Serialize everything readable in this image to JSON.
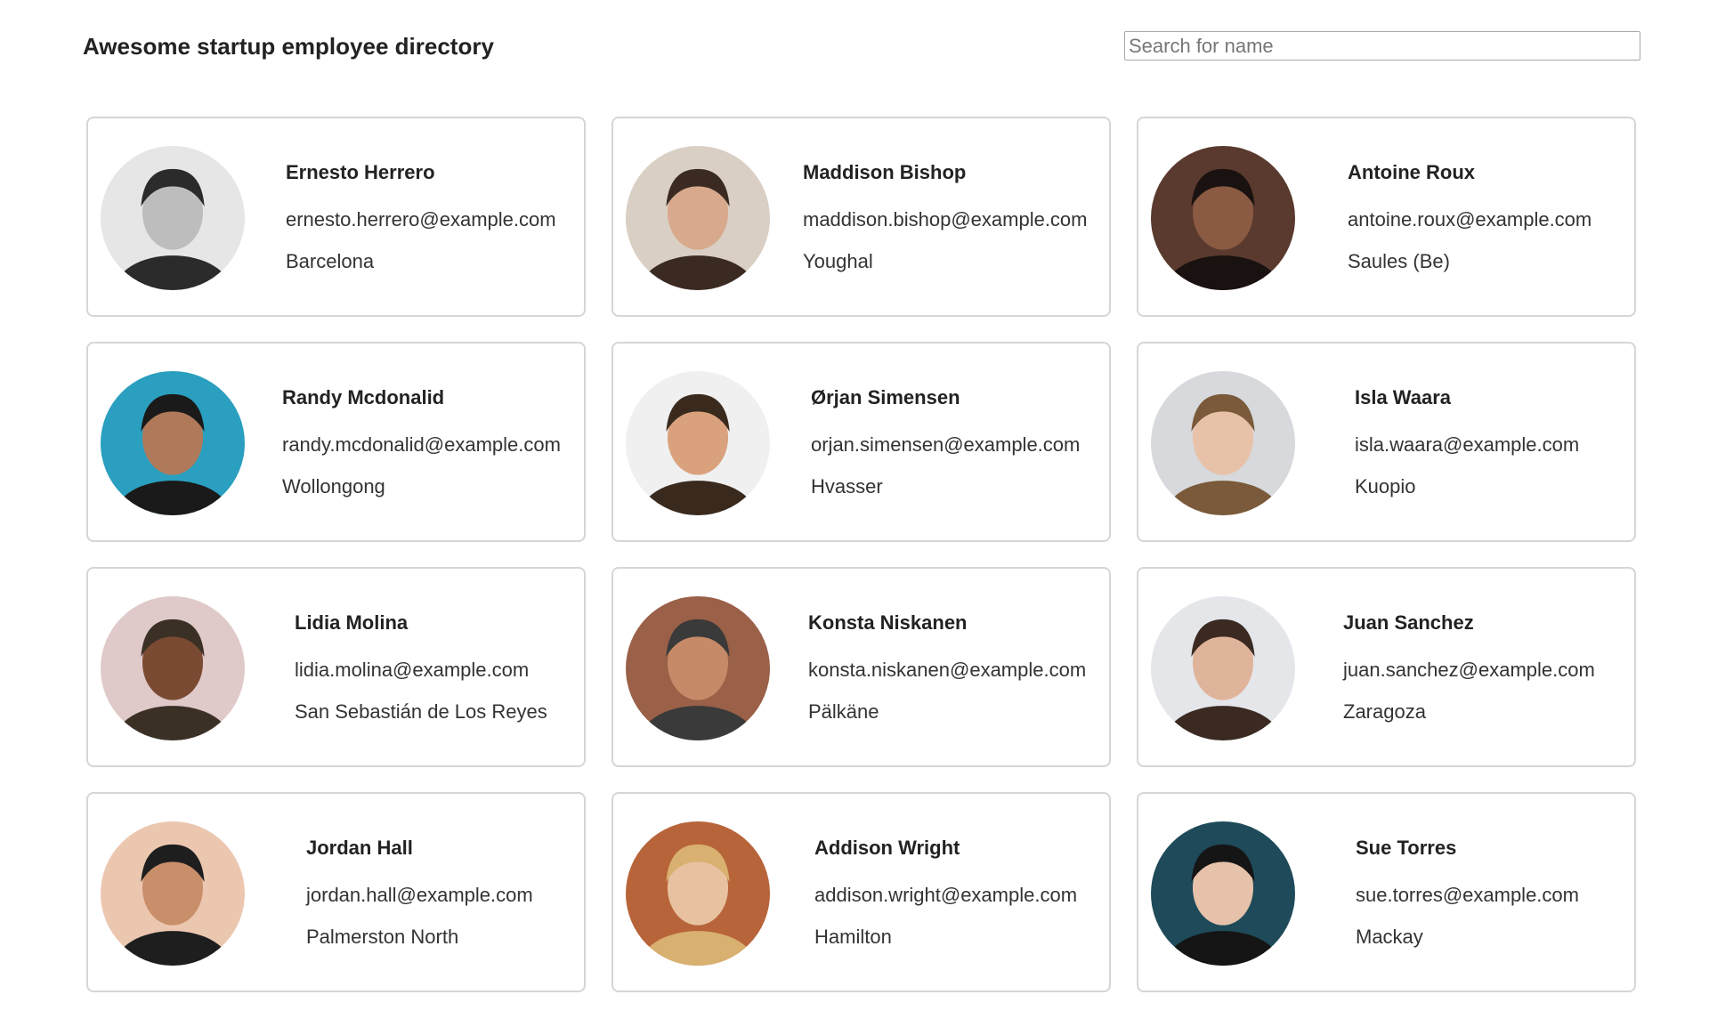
{
  "header": {
    "title": "Awesome startup employee directory",
    "search_placeholder": "Search for name",
    "search_value": ""
  },
  "colors": {
    "card_border": "#d6d6d6",
    "text": "#222222",
    "search_border": "#a8a8a8"
  },
  "employees": [
    {
      "name": "Ernesto Herrero",
      "email": "ernesto.herrero@example.com",
      "city": "Barcelona",
      "photo": "avatar-photo",
      "palette": [
        "#e6e6e6",
        "#2b2b2b",
        "#bdbdbd"
      ]
    },
    {
      "name": "Maddison Bishop",
      "email": "maddison.bishop@example.com",
      "city": "Youghal",
      "photo": "avatar-photo",
      "palette": [
        "#d9cfc4",
        "#3a2a22",
        "#d8a98c"
      ]
    },
    {
      "name": "Antoine Roux",
      "email": "antoine.roux@example.com",
      "city": "Saules (Be)",
      "photo": "avatar-photo",
      "palette": [
        "#5a3a2e",
        "#1a1210",
        "#8a5a42"
      ]
    },
    {
      "name": "Randy Mcdonalid",
      "email": "randy.mcdonalid@example.com",
      "city": "Wollongong",
      "photo": "avatar-photo",
      "palette": [
        "#2a9fbf",
        "#1a1a1a",
        "#b07a5a"
      ]
    },
    {
      "name": "Ørjan Simensen",
      "email": "orjan.simensen@example.com",
      "city": "Hvasser",
      "photo": "avatar-photo",
      "palette": [
        "#f0f0f0",
        "#3a2a1e",
        "#d9a27d"
      ]
    },
    {
      "name": "Isla Waara",
      "email": "isla.waara@example.com",
      "city": "Kuopio",
      "photo": "avatar-photo",
      "palette": [
        "#d7d9dc",
        "#7a5a3a",
        "#e8c2a8"
      ]
    },
    {
      "name": "Lidia Molina",
      "email": "lidia.molina@example.com",
      "city": "San Sebastián de Los Reyes",
      "photo": "avatar-photo",
      "palette": [
        "#e0c9c9",
        "#3a3026",
        "#7a4a32"
      ]
    },
    {
      "name": "Konsta Niskanen",
      "email": "konsta.niskanen@example.com",
      "city": "Pälkäne",
      "photo": "avatar-photo",
      "palette": [
        "#9a6048",
        "#3a3a3a",
        "#c68a68"
      ]
    },
    {
      "name": "Juan Sanchez",
      "email": "juan.sanchez@example.com",
      "city": "Zaragoza",
      "photo": "avatar-photo",
      "palette": [
        "#e4e6ea",
        "#3a2a22",
        "#e0b49a"
      ]
    },
    {
      "name": "Jordan Hall",
      "email": "jordan.hall@example.com",
      "city": "Palmerston North",
      "photo": "avatar-photo",
      "palette": [
        "#ecc7b0",
        "#1e1e1e",
        "#c98e6a"
      ]
    },
    {
      "name": "Addison Wright",
      "email": "addison.wright@example.com",
      "city": "Hamilton",
      "photo": "avatar-photo",
      "palette": [
        "#b8643a",
        "#d8b070",
        "#e8c2a0"
      ]
    },
    {
      "name": "Sue Torres",
      "email": "sue.torres@example.com",
      "city": "Mackay",
      "photo": "avatar-photo",
      "palette": [
        "#1e4a5a",
        "#151515",
        "#e6c2aa"
      ]
    }
  ]
}
